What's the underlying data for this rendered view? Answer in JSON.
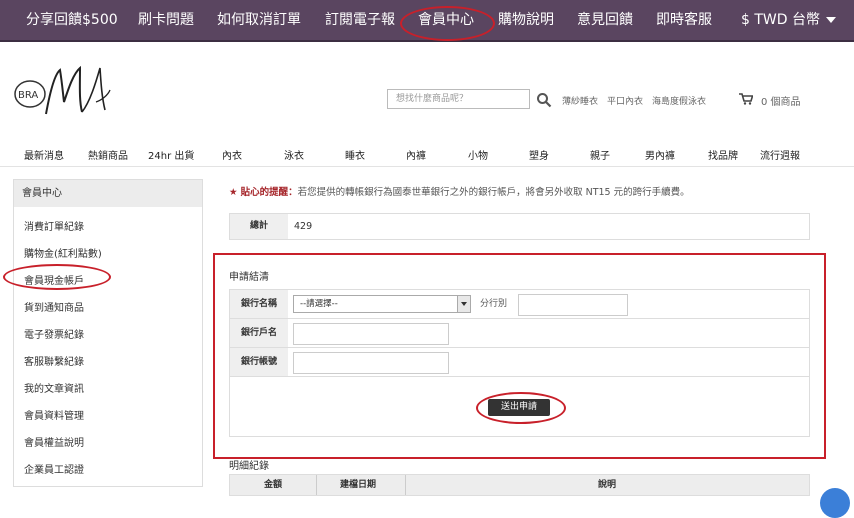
{
  "topbar": {
    "items": [
      "分享回饋$500",
      "刷卡問題",
      "如何取消訂單",
      "訂閱電子報",
      "會員中心",
      "購物說明",
      "意見回饋",
      "即時客服"
    ],
    "currency": "$ TWD 台幣"
  },
  "header": {
    "logo_text": "BRA",
    "search_placeholder": "想找什麼商品呢？",
    "quick_links": [
      "薄紗睡衣",
      "平口內衣",
      "海島度假泳衣"
    ],
    "cart_text": "0 個商品"
  },
  "categories": [
    "最新消息",
    "熱銷商品",
    "24hr 出貨",
    "內衣",
    "泳衣",
    "睡衣",
    "內褲",
    "小物",
    "塑身",
    "親子",
    "男內褲",
    "找品牌",
    "流行週報"
  ],
  "sidebar": {
    "title": "會員中心",
    "items": [
      "消費訂單紀錄",
      "購物金(紅利點數)",
      "會員現金帳戶",
      "貨到通知商品",
      "電子發票紀錄",
      "客服聯繫紀錄",
      "我的文章資訊",
      "會員資料管理",
      "會員權益說明",
      "企業員工認證"
    ]
  },
  "notice": {
    "star": "★",
    "label": "貼心的提醒：",
    "text": "若您提供的轉帳銀行為國泰世華銀行之外的銀行帳戶，將會另外收取 NT15 元的跨行手續費。"
  },
  "total": {
    "label": "總計",
    "value": "429"
  },
  "apply": {
    "title": "申請結清",
    "bank_name_label": "銀行名稱",
    "bank_select_value": "--請選擇--",
    "branch_label": "分行別",
    "account_name_label": "銀行戶名",
    "account_no_label": "銀行帳號",
    "submit_label": "送出申請"
  },
  "detail": {
    "title": "明細紀錄",
    "columns": [
      "金額",
      "建檔日期",
      "說明"
    ]
  },
  "colors": {
    "topbar": "#5a4560",
    "highlight": "#c8202a",
    "accent": "#a6262b"
  }
}
